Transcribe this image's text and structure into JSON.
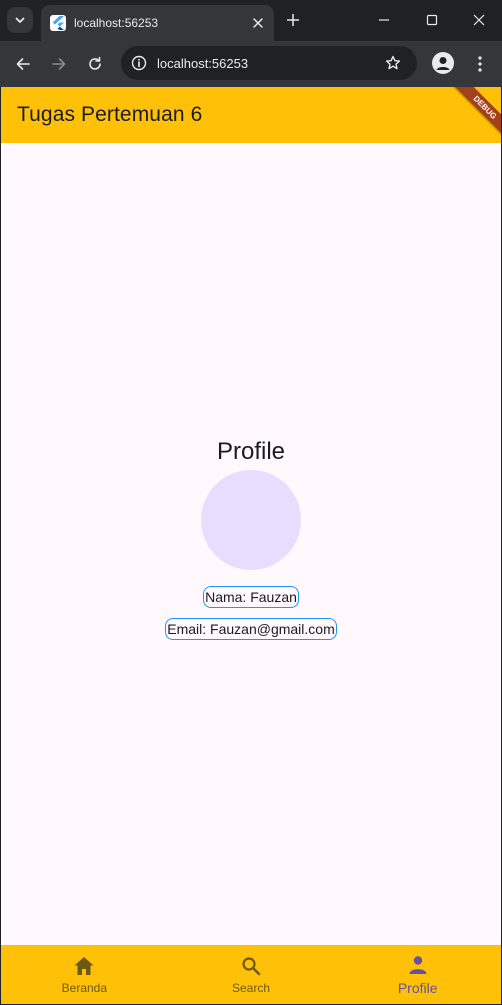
{
  "browser": {
    "tab_title": "localhost:56253",
    "url": "localhost:56253"
  },
  "app": {
    "title": "Tugas Pertemuan 6",
    "debug_label": "DEBUG",
    "accent_color": "#ffc107"
  },
  "profile": {
    "heading": "Profile",
    "name_text": "Nama: Fauzan",
    "email_text": "Email: Fauzan@gmail.com"
  },
  "bottom_nav": {
    "items": [
      {
        "label": "Beranda",
        "icon": "home-icon"
      },
      {
        "label": "Search",
        "icon": "search-icon"
      },
      {
        "label": "Profile",
        "icon": "person-icon"
      }
    ],
    "active_index": 2
  }
}
